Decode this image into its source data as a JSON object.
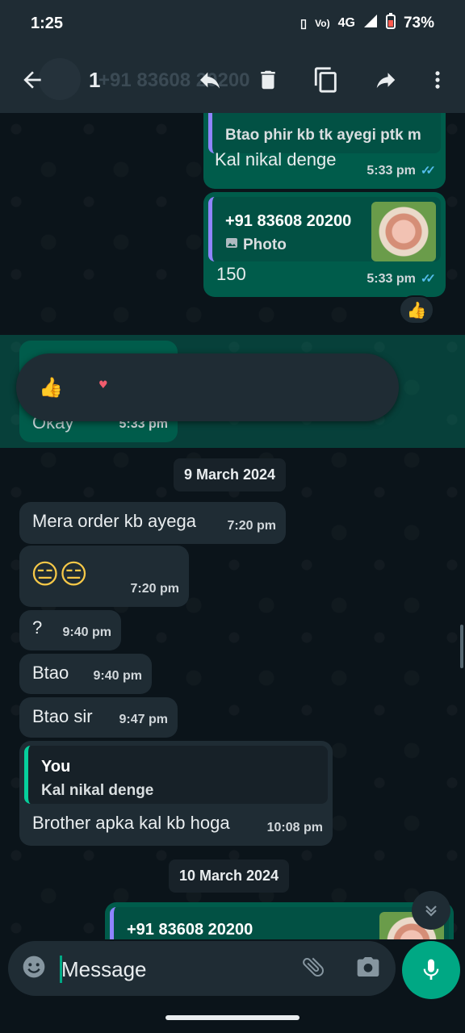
{
  "status_bar": {
    "time": "1:25",
    "network": "4G",
    "battery": "73%"
  },
  "app_bar": {
    "selected_count": "1",
    "contact_name": "+91 83608 20200",
    "icons": [
      "back-arrow-icon",
      "reply-icon",
      "delete-icon",
      "copy-icon",
      "forward-icon",
      "more-vert-icon"
    ]
  },
  "messages": {
    "m1": {
      "quote_text": "Btao phir kb tk ayegi ptk m",
      "text": "Kal nikal denge",
      "time": "5:33 pm"
    },
    "m2": {
      "quote_name": "+91 83608 20200",
      "quote_type": "Photo",
      "text": "150",
      "time": "5:33 pm",
      "reaction": "👍"
    },
    "m3": {
      "text": "Okay",
      "time": "5:33 pm"
    },
    "reaction_picker": {
      "emojis": [
        "👍",
        "♥"
      ]
    },
    "date1": "9 March 2024",
    "m4": {
      "text": "Mera order kb ayega",
      "time": "7:20 pm"
    },
    "m5": {
      "text": "😑😑",
      "time": "7:20 pm"
    },
    "m6": {
      "text": "?",
      "time": "9:40 pm"
    },
    "m7": {
      "text": "Btao",
      "time": "9:40 pm"
    },
    "m8": {
      "text": "Btao sir",
      "time": "9:47 pm"
    },
    "m9": {
      "quote_name": "You",
      "quote_text": "Kal nikal denge",
      "text": "Brother apka kal kb hoga",
      "time": "10:08 pm"
    },
    "date2": "10 March 2024",
    "m10": {
      "quote_name": "+91 83608 20200"
    }
  },
  "composer": {
    "placeholder": "Message"
  },
  "colors": {
    "background": "#0b141a",
    "outgoing": "#005c4b",
    "incoming": "#1f2c34",
    "accent": "#00a884",
    "read_ticks": "#53bdeb"
  }
}
